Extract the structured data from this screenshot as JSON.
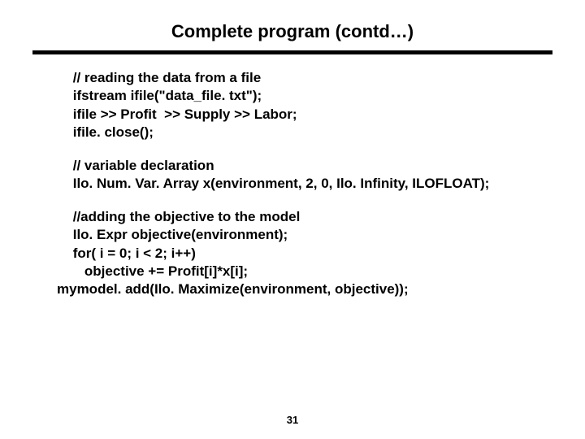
{
  "title": "Complete program (contd…)",
  "code": {
    "block1": {
      "l1": " // reading the data from a file",
      "l2": " ifstream ifile(\"data_file. txt\");",
      "l3": " ifile >> Profit  >> Supply >> Labor;",
      "l4": " ifile. close();"
    },
    "block2": {
      "l1": " // variable declaration",
      "l2": " Ilo. Num. Var. Array x(environment, 2, 0, Ilo. Infinity, ILOFLOAT);"
    },
    "block3": {
      "l1": " //adding the objective to the model",
      "l2": " Ilo. Expr objective(environment);",
      "l3": " for( i = 0; i < 2; i++)",
      "l4": "    objective += Profit[i]*x[i];",
      "l5": "mymodel. add(Ilo. Maximize(environment, objective));"
    }
  },
  "page_number": "31"
}
